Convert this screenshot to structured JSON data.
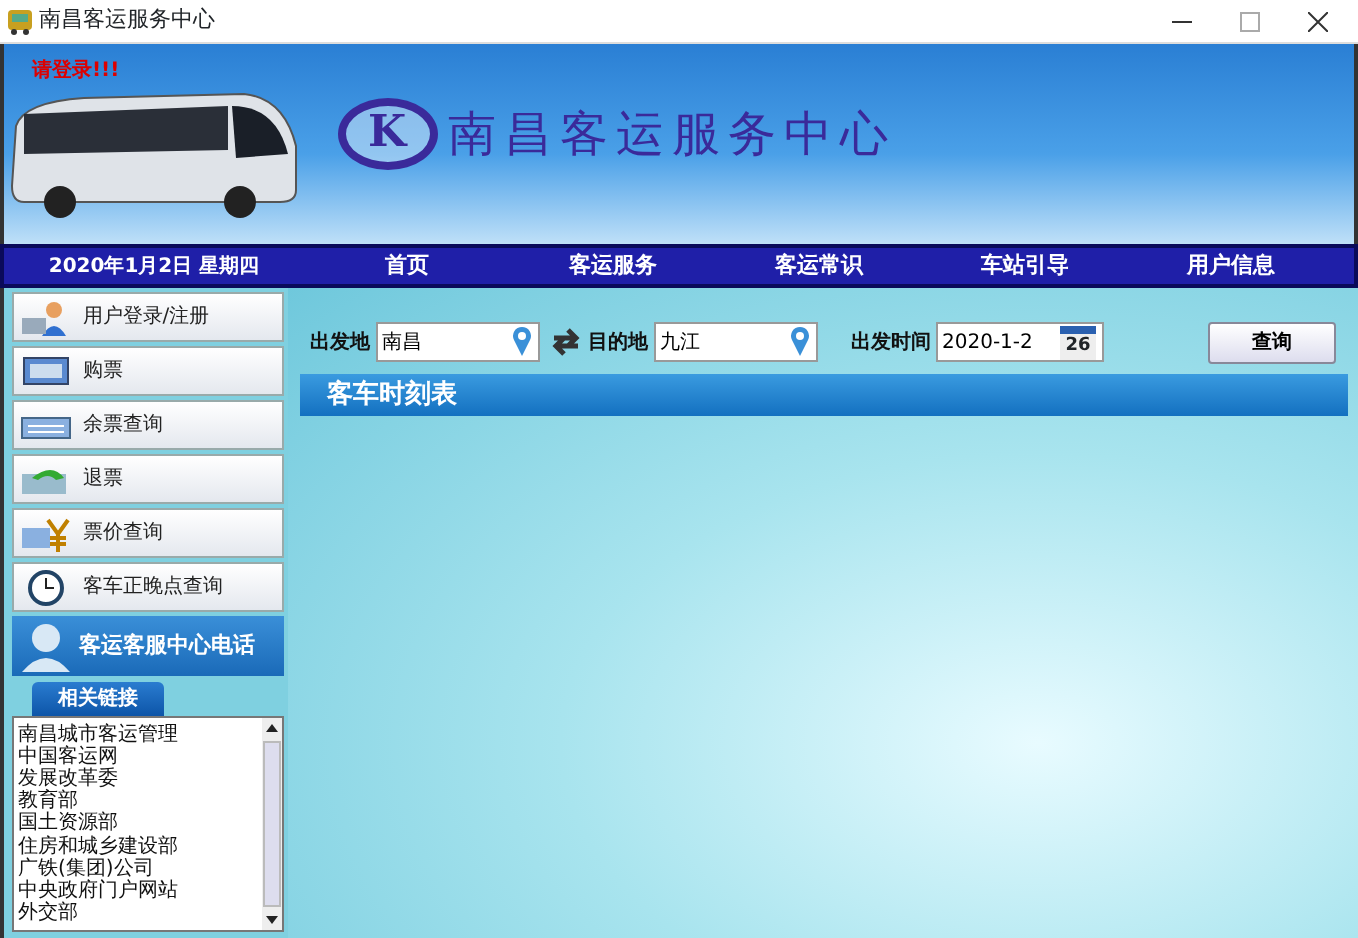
{
  "window": {
    "title": "南昌客运服务中心"
  },
  "banner": {
    "login_notice": "请登录!!!",
    "logo_mark": "K",
    "site_title": "南昌客运服务中心"
  },
  "nav": {
    "date": "2020年1月2日 星期四",
    "items": [
      {
        "label": "首页"
      },
      {
        "label": "客运服务"
      },
      {
        "label": "客运常识"
      },
      {
        "label": "车站引导"
      },
      {
        "label": "用户信息"
      }
    ]
  },
  "sidebar": {
    "items": [
      {
        "label": "用户登录/注册",
        "kind": "user"
      },
      {
        "label": "购票",
        "kind": "screen"
      },
      {
        "label": "余票查询",
        "kind": "keyboard"
      },
      {
        "label": "退票",
        "kind": "return"
      },
      {
        "label": "票价查询",
        "kind": "yen"
      },
      {
        "label": "客车正晚点查询",
        "kind": "clock"
      }
    ],
    "hotline": "客运客服中心电话",
    "links_title": "相关链接",
    "links": [
      "南昌城市客运管理",
      "中国客运网",
      "发展改革委",
      "教育部",
      "国土资源部",
      "住房和城乡建设部",
      "广铁(集团)公司",
      "中央政府门户网站",
      "外交部"
    ]
  },
  "search": {
    "from_label": "出发地",
    "from_value": "南昌",
    "to_label": "目的地",
    "to_value": "九江",
    "date_label": "出发时间",
    "date_value": "2020-1-2",
    "calendar_day": "26",
    "button": "查询"
  },
  "timetable": {
    "title": "客车时刻表"
  }
}
